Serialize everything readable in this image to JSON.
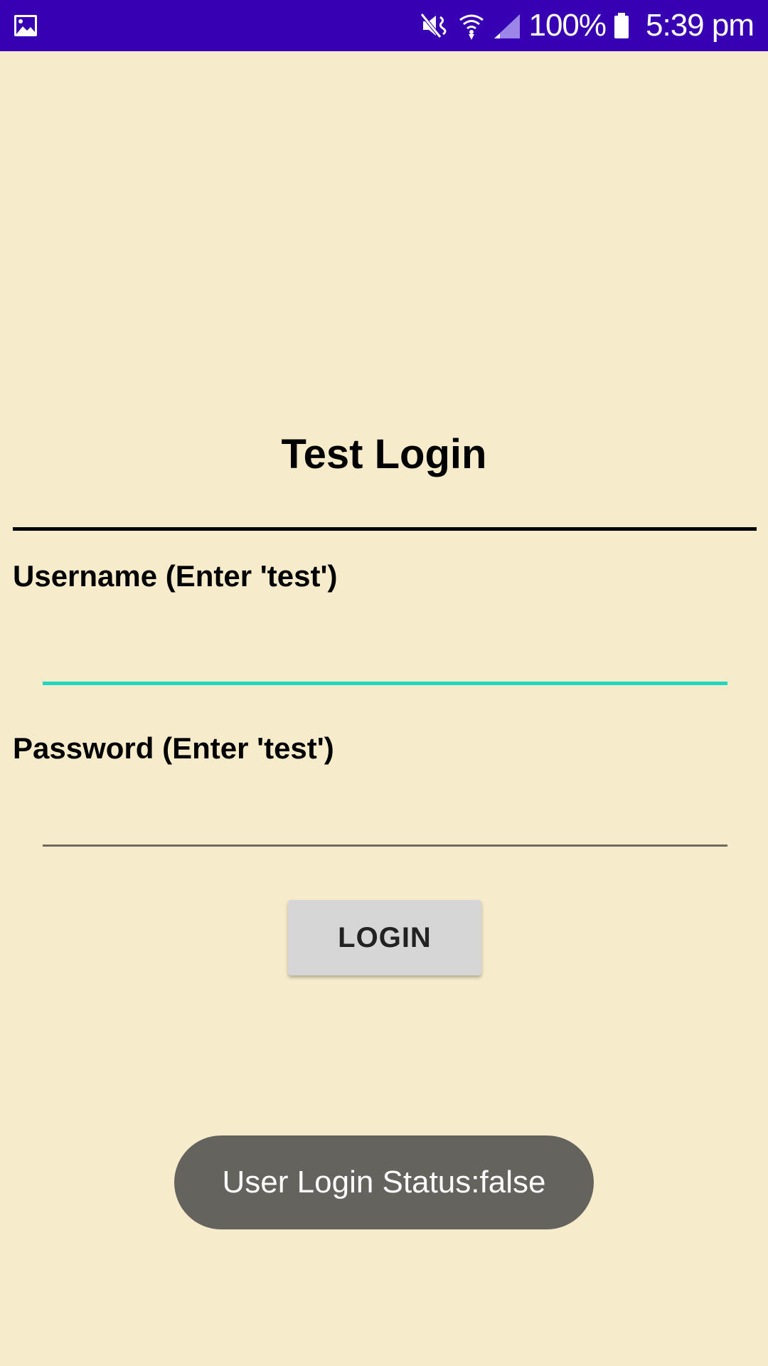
{
  "status_bar": {
    "left_icon": "image-notification-icon",
    "icons": [
      "mute-icon",
      "wifi-icon",
      "signal-icon",
      "battery-icon"
    ],
    "battery": "100%",
    "time": "5:39 pm",
    "bg_color": "#3700b3"
  },
  "login_form": {
    "title": "Test Login",
    "username_label": "Username (Enter 'test')",
    "username_value": "",
    "password_label": "Password (Enter 'test')",
    "password_value": "",
    "login_button_label": "LOGIN"
  },
  "toast": {
    "message": "User Login Status:false"
  },
  "colors": {
    "background": "#f6ebcb",
    "accent": "#1fd6c0",
    "button": "#d6d6d6",
    "toast": "#65635e"
  }
}
